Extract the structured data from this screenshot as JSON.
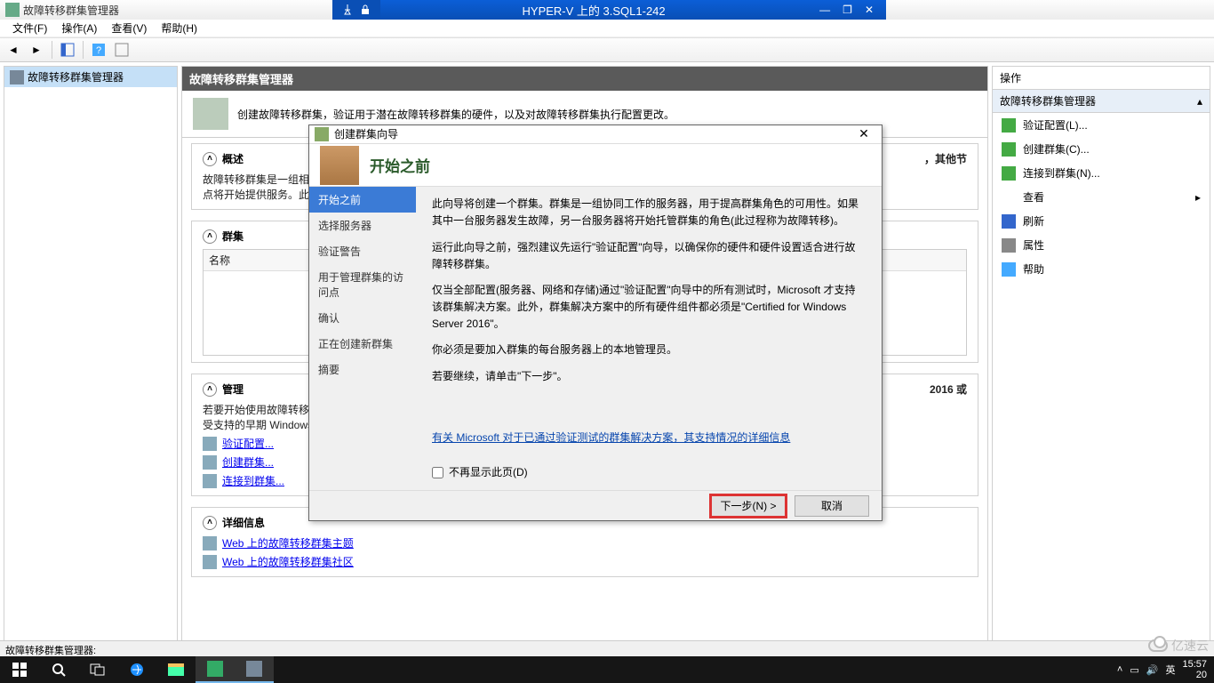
{
  "outer_window": {
    "min": "—",
    "max": "❐",
    "close": "✕"
  },
  "vm_bar": {
    "title": "HYPER-V 上的 3.SQL1-242"
  },
  "app_title": "故障转移群集管理器",
  "menu": {
    "file": "文件(F)",
    "action": "操作(A)",
    "view": "查看(V)",
    "help": "帮助(H)"
  },
  "tree": {
    "root": "故障转移群集管理器"
  },
  "center": {
    "header": "故障转移群集管理器",
    "intro": "创建故障转移群集，验证用于潜在故障转移群集的硬件，以及对故障转移群集执行配置更改。",
    "overview": {
      "title": "概述",
      "text": "故障转移群集是一组相互独立的计算机，这些计算机相互协作以提高服务器角色的可用性。群集中的服务器(称为节点)",
      "text2": "点将开始提供服务。此过程",
      "extra": "，其他节"
    },
    "clusters": {
      "title": "群集",
      "col_name": "名称"
    },
    "manage": {
      "title": "管理",
      "text": "若要开始使用故障转移群集功能，请首先验证硬件配置，然后创建群集。完成这些步骤后，即可使用",
      "text2": "受支持的早期 Windows S",
      "extra": "2016 或",
      "link_validate": "验证配置...",
      "link_create": "创建群集...",
      "link_connect": "连接到群集..."
    },
    "details": {
      "title": "详细信息",
      "link1": "Web 上的故障转移群集主题",
      "link2": "Web 上的故障转移群集社区"
    }
  },
  "actions": {
    "header": "操作",
    "section": "故障转移群集管理器",
    "items": {
      "validate": "验证配置(L)...",
      "create": "创建群集(C)...",
      "connect": "连接到群集(N)...",
      "view": "查看",
      "refresh": "刷新",
      "properties": "属性",
      "help": "帮助"
    }
  },
  "wizard": {
    "title": "创建群集向导",
    "heading": "开始之前",
    "nav": {
      "before": "开始之前",
      "select": "选择服务器",
      "warn": "验证警告",
      "access": "用于管理群集的访问点",
      "confirm": "确认",
      "creating": "正在创建新群集",
      "summary": "摘要"
    },
    "para1": "此向导将创建一个群集。群集是一组协同工作的服务器，用于提高群集角色的可用性。如果其中一台服务器发生故障，另一台服务器将开始托管群集的角色(此过程称为故障转移)。",
    "para2": "运行此向导之前，强烈建议先运行\"验证配置\"向导，以确保你的硬件和硬件设置适合进行故障转移群集。",
    "para3": "仅当全部配置(服务器、网络和存储)通过\"验证配置\"向导中的所有测试时，Microsoft 才支持该群集解决方案。此外，群集解决方案中的所有硬件组件都必须是\"Certified for Windows Server 2016\"。",
    "para4": "你必须是要加入群集的每台服务器上的本地管理员。",
    "para5": "若要继续，请单击\"下一步\"。",
    "link": "有关 Microsoft 对于已通过验证测试的群集解决方案，其支持情况的详细信息",
    "checkbox": "不再显示此页(D)",
    "next": "下一步(N) >",
    "cancel": "取消"
  },
  "status_bar": "故障转移群集管理器:",
  "tray": {
    "ime": "英",
    "time": "15:57",
    "date": "20"
  },
  "watermark": "亿速云"
}
